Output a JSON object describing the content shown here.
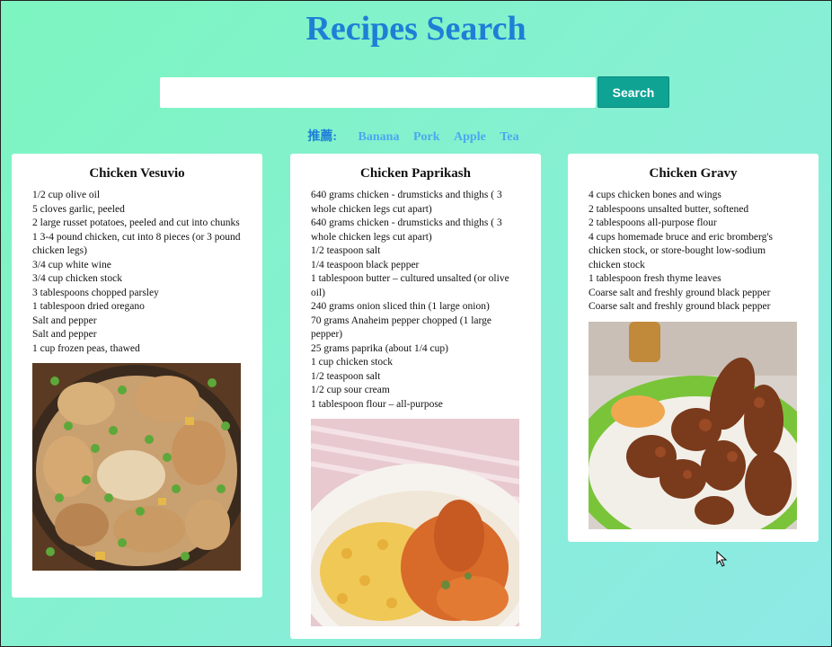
{
  "page": {
    "title": "Recipes Search"
  },
  "search": {
    "placeholder": "",
    "value": "",
    "button_label": "Search"
  },
  "recommend": {
    "label": "推薦:",
    "items": [
      "Banana",
      "Pork",
      "Apple",
      "Tea"
    ]
  },
  "recipes": [
    {
      "title": "Chicken Vesuvio",
      "ingredients": [
        "1/2 cup olive oil",
        "5 cloves garlic, peeled",
        "2 large russet potatoes, peeled and cut into chunks",
        "1 3-4 pound chicken, cut into 8 pieces (or 3 pound chicken legs)",
        "3/4 cup white wine",
        "3/4 cup chicken stock",
        "3 tablespoons chopped parsley",
        "1 tablespoon dried oregano",
        "Salt and pepper",
        "Salt and pepper",
        "1 cup frozen peas, thawed"
      ]
    },
    {
      "title": "Chicken Paprikash",
      "ingredients": [
        "640 grams chicken - drumsticks and thighs ( 3 whole chicken legs cut apart)",
        "640 grams chicken - drumsticks and thighs ( 3 whole chicken legs cut apart)",
        "1/2 teaspoon salt",
        "1/4 teaspoon black pepper",
        "1 tablespoon butter – cultured unsalted (or olive oil)",
        "240 grams onion sliced thin (1 large onion)",
        "70 grams Anaheim pepper chopped (1 large pepper)",
        "25 grams paprika (about 1/4 cup)",
        "1 cup chicken stock",
        "1/2 teaspoon salt",
        "1/2 cup sour cream",
        "1 tablespoon flour – all-purpose"
      ]
    },
    {
      "title": "Chicken Gravy",
      "ingredients": [
        "4 cups chicken bones and wings",
        "2 tablespoons unsalted butter, softened",
        "2 tablespoons all-purpose flour",
        "4 cups homemade bruce and eric bromberg's chicken stock, or store-bought low-sodium chicken stock",
        "1 tablespoon fresh thyme leaves",
        "Coarse salt and freshly ground black pepper",
        "Coarse salt and freshly ground black pepper"
      ]
    }
  ],
  "colors": {
    "title": "#1e7fd6",
    "button": "#0fa394",
    "link": "#4ba8f0"
  }
}
